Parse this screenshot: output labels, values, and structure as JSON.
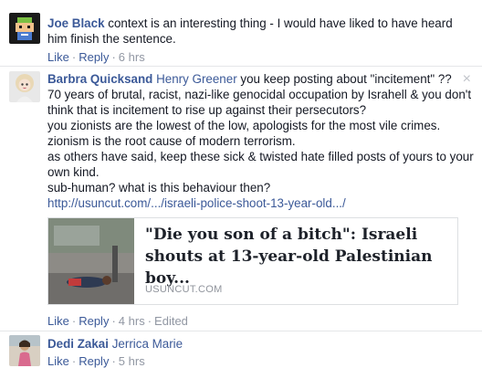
{
  "comments": [
    {
      "author": "Joe Black",
      "text": "context is an interesting thing - I would have liked to have heard him finish the sentence.",
      "actions": {
        "like": "Like",
        "reply": "Reply",
        "time": "6 hrs"
      }
    },
    {
      "author": "Barbra Quicksand",
      "mention": "Henry Greener",
      "lines": [
        "you keep posting about \"incitement\" ??",
        "70 years of brutal, racist, nazi-like genocidal occupation by Israhell & you don't think that is incitement to rise up against their persecutors?",
        "you zionists are the lowest of the low, apologists for the most vile crimes. zionism is the root cause of modern terrorism.",
        "as others have said, keep these sick & twisted hate filled posts of yours to your own kind.",
        "sub-human? what is this behaviour then?"
      ],
      "link": "http://usuncut.com/.../israeli-police-shoot-13-year-old.../",
      "card": {
        "title": "\"Die you son of a bitch\": Israeli shouts at 13-year-old Palestinian boy...",
        "domain": "USUNCUT.COM"
      },
      "actions": {
        "like": "Like",
        "reply": "Reply",
        "time": "4 hrs",
        "edited": "Edited"
      },
      "close": "×"
    },
    {
      "author": "Dedi Zakai",
      "mention": "Jerrica Marie",
      "actions": {
        "like": "Like",
        "reply": "Reply",
        "time": "5 hrs"
      }
    }
  ],
  "colors": {
    "link": "#3b5998",
    "meta": "#9197a3",
    "text": "#141823"
  }
}
